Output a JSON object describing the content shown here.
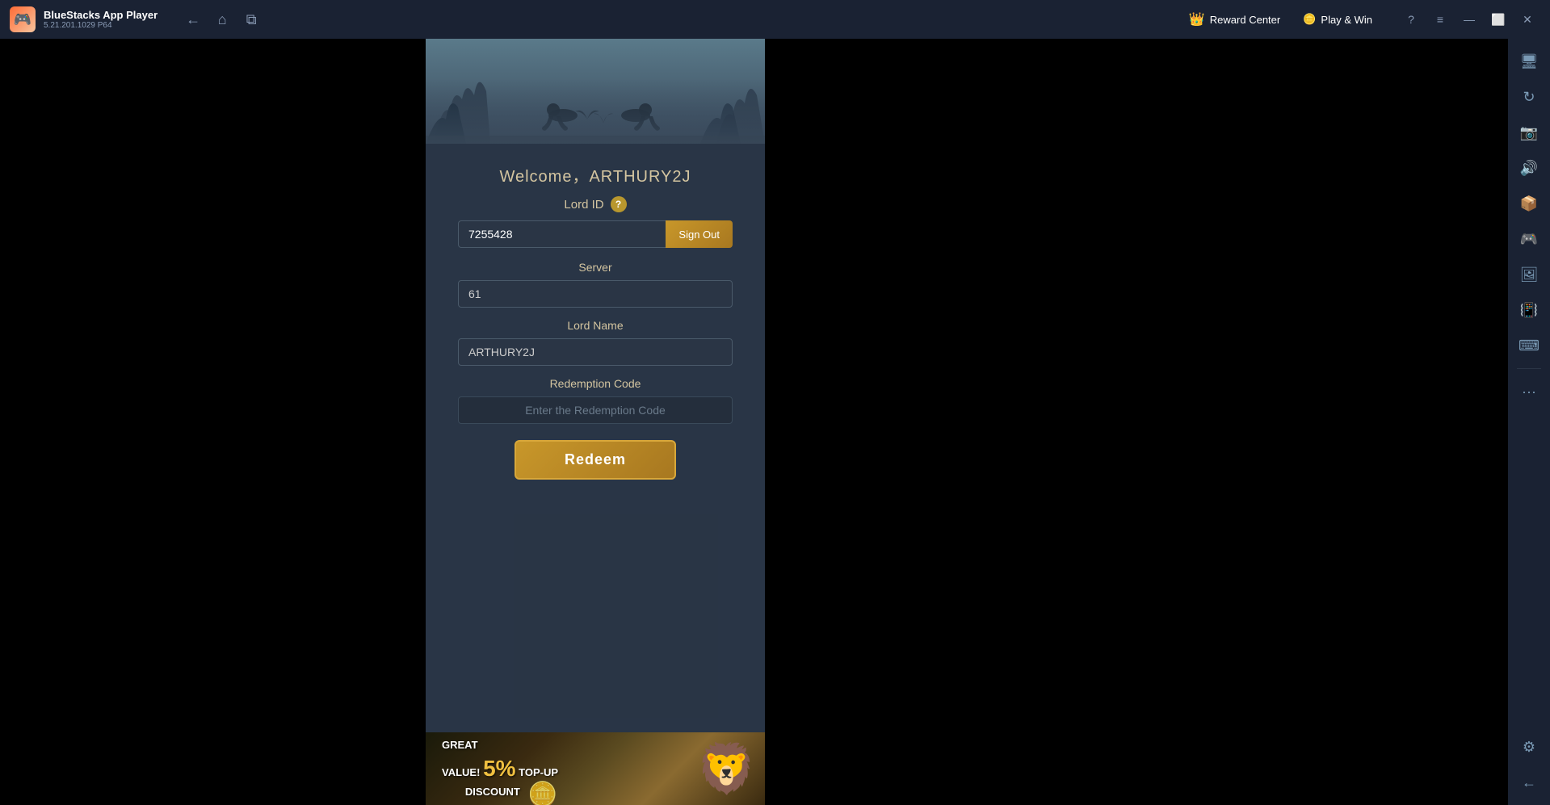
{
  "app": {
    "name": "BlueStacks App Player",
    "version": "5.21.201.1029  P64",
    "logo_emoji": "🎮"
  },
  "titlebar": {
    "back_label": "←",
    "home_label": "⌂",
    "multi_label": "⧉",
    "reward_center_label": "Reward Center",
    "reward_icon": "👑",
    "play_win_label": "Play & Win",
    "play_win_icon": "🪙",
    "help_label": "?",
    "menu_label": "≡",
    "minimize_label": "—",
    "maximize_label": "⬜",
    "close_label": "✕"
  },
  "game": {
    "welcome_text": "Welcome，ARTHURY2J",
    "lord_id_label": "Lord ID",
    "lord_id_value": "7255428",
    "sign_out_label": "Sign Out",
    "server_label": "Server",
    "server_value": "61",
    "lord_name_label": "Lord Name",
    "lord_name_value": "ARTHURY2J",
    "redemption_code_label": "Redemption Code",
    "redemption_placeholder": "Enter the Redemption Code",
    "redeem_label": "Redeem"
  },
  "banner": {
    "great_value": "GREAT",
    "value_label": "VALUE!",
    "percent": "5%",
    "topup": "TOP-UP",
    "discount": "DISCOUNT"
  },
  "sidebar": {
    "icons": [
      {
        "name": "settings-icon",
        "symbol": "⚙"
      },
      {
        "name": "display-icon",
        "symbol": "🖥"
      },
      {
        "name": "rotate-icon",
        "symbol": "↻"
      },
      {
        "name": "camera-icon",
        "symbol": "📷"
      },
      {
        "name": "apk-icon",
        "symbol": "📦"
      },
      {
        "name": "controller-icon",
        "symbol": "🎮"
      },
      {
        "name": "screenshot-icon",
        "symbol": "🖼"
      },
      {
        "name": "shake-icon",
        "symbol": "📳"
      },
      {
        "name": "keyboard-icon",
        "symbol": "⌨"
      },
      {
        "name": "more-icon",
        "symbol": "•••"
      },
      {
        "name": "gear-icon",
        "symbol": "⚙"
      },
      {
        "name": "arrow-back-icon",
        "symbol": "←"
      }
    ]
  }
}
